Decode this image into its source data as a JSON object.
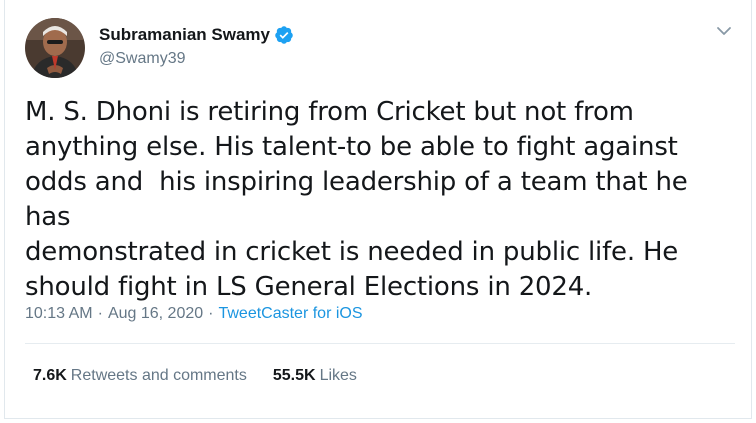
{
  "user": {
    "display_name": "Subramanian Swamy",
    "handle": "@Swamy39",
    "verified": true,
    "avatar_icon": "avatar-photo"
  },
  "tweet": {
    "text": "M. S. Dhoni is retiring from Cricket but not from\nanything else. His talent-to be able to fight against\nodds and  his inspiring leadership of a team that he has\ndemonstrated in cricket is needed in public life. He\nshould fight in LS General Elections in 2024.",
    "time": "10:13 AM",
    "separator": "·",
    "date": "Aug 16, 2020",
    "source": "TweetCaster for iOS"
  },
  "stats": {
    "retweets_count": "7.6K",
    "retweets_label": "Retweets and comments",
    "likes_count": "55.5K",
    "likes_label": "Likes"
  },
  "colors": {
    "link": "#1b95e0",
    "secondary_text": "#657786",
    "primary_text": "#14171a",
    "verified_badge": "#1da1f2"
  },
  "icons": {
    "verified": "verified-badge-icon",
    "menu": "chevron-down-icon"
  }
}
